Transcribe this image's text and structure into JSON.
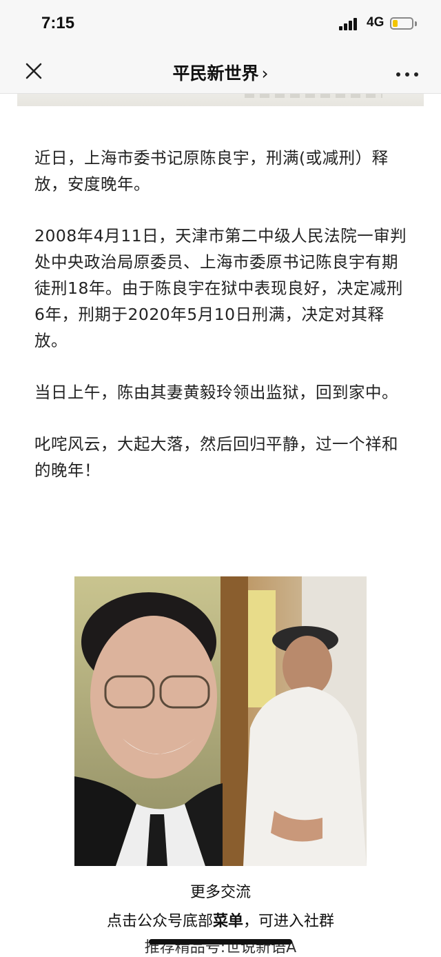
{
  "status_bar": {
    "time": "7:15",
    "network": "4G",
    "battery_level": 0.25,
    "battery_color": "#f2c500"
  },
  "nav": {
    "close_icon": "close-icon",
    "title": "平民新世界",
    "chevron": "›",
    "more_icon": "more-dots-icon"
  },
  "article": {
    "paragraphs": [
      "近日，上海市委书记原陈良宇，刑满(或减刑）释放，安度晚年。",
      "2008年4月11日，天津市第二中级人民法院一审判处中央政治局原委员、上海市委原书记陈良宇有期徒刑18年。由于陈良宇在狱中表现良好，决定减刑6年，刑期于2020年5月10日刑满，决定对其释放。",
      "当日上午，陈由其妻黄毅玲领出监狱，回到家中。",
      "叱咤风云，大起大落，然后回归平静，过一个祥和的晚年！"
    ]
  },
  "footer": {
    "line1": "更多交流",
    "line2_prefix": "点击公众号底部",
    "line2_bold": "菜单",
    "line2_suffix": "，可进入社群",
    "line3": "推荐精品号:世说新语A"
  }
}
